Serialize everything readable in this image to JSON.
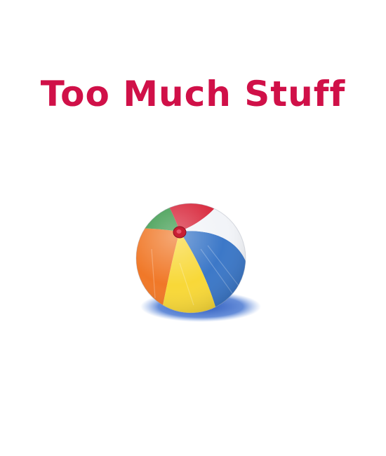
{
  "page": {
    "title": "Too Much Stuff"
  },
  "illustration": {
    "subject": "beach-ball-icon"
  },
  "colors": {
    "title": "#d01048",
    "background": "#ffffff",
    "ball_red": "#d8283c",
    "ball_green": "#3c9a4c",
    "ball_orange": "#f07828",
    "ball_yellow": "#f8d838",
    "ball_blue": "#3c78c8",
    "shadow": "#2c5cc0"
  }
}
